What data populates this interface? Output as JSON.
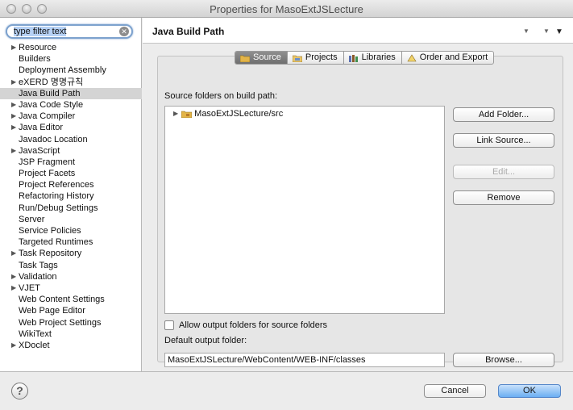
{
  "window": {
    "title": "Properties for MasoExtJSLecture"
  },
  "sidebar": {
    "filter": {
      "value": "type filter text"
    },
    "items": [
      {
        "label": "Resource",
        "expandable": true
      },
      {
        "label": "Builders",
        "expandable": false
      },
      {
        "label": "Deployment Assembly",
        "expandable": false
      },
      {
        "label": "eXERD 명명규칙",
        "expandable": true
      },
      {
        "label": "Java Build Path",
        "expandable": false,
        "selected": true
      },
      {
        "label": "Java Code Style",
        "expandable": true
      },
      {
        "label": "Java Compiler",
        "expandable": true
      },
      {
        "label": "Java Editor",
        "expandable": true
      },
      {
        "label": "Javadoc Location",
        "expandable": false
      },
      {
        "label": "JavaScript",
        "expandable": true
      },
      {
        "label": "JSP Fragment",
        "expandable": false
      },
      {
        "label": "Project Facets",
        "expandable": false
      },
      {
        "label": "Project References",
        "expandable": false
      },
      {
        "label": "Refactoring History",
        "expandable": false
      },
      {
        "label": "Run/Debug Settings",
        "expandable": false
      },
      {
        "label": "Server",
        "expandable": false
      },
      {
        "label": "Service Policies",
        "expandable": false
      },
      {
        "label": "Targeted Runtimes",
        "expandable": false
      },
      {
        "label": "Task Repository",
        "expandable": true
      },
      {
        "label": "Task Tags",
        "expandable": false
      },
      {
        "label": "Validation",
        "expandable": true
      },
      {
        "label": "VJET",
        "expandable": true
      },
      {
        "label": "Web Content Settings",
        "expandable": false
      },
      {
        "label": "Web Page Editor",
        "expandable": false
      },
      {
        "label": "Web Project Settings",
        "expandable": false
      },
      {
        "label": "WikiText",
        "expandable": false
      },
      {
        "label": "XDoclet",
        "expandable": true
      }
    ]
  },
  "header": {
    "title": "Java Build Path"
  },
  "tabs": [
    {
      "label": "Source",
      "icon": "source-folder-icon",
      "active": true
    },
    {
      "label": "Projects",
      "icon": "projects-icon",
      "active": false
    },
    {
      "label": "Libraries",
      "icon": "libraries-icon",
      "active": false
    },
    {
      "label": "Order and Export",
      "icon": "order-export-icon",
      "active": false
    }
  ],
  "source": {
    "folders_label": "Source folders on build path:",
    "folders": [
      {
        "label": "MasoExtJSLecture/src"
      }
    ],
    "buttons": {
      "add_folder": "Add Folder...",
      "link_source": "Link Source...",
      "edit": "Edit...",
      "remove": "Remove",
      "browse": "Browse..."
    },
    "allow_output_label": "Allow output folders for source folders",
    "output_label": "Default output folder:",
    "output_value": "MasoExtJSLecture/WebContent/WEB-INF/classes"
  },
  "footer": {
    "cancel": "Cancel",
    "ok": "OK",
    "help": "?"
  },
  "colors": {
    "accent": "#6aaef2",
    "selection": "#d4d4d4",
    "tab_active": "#7a7a7a"
  }
}
